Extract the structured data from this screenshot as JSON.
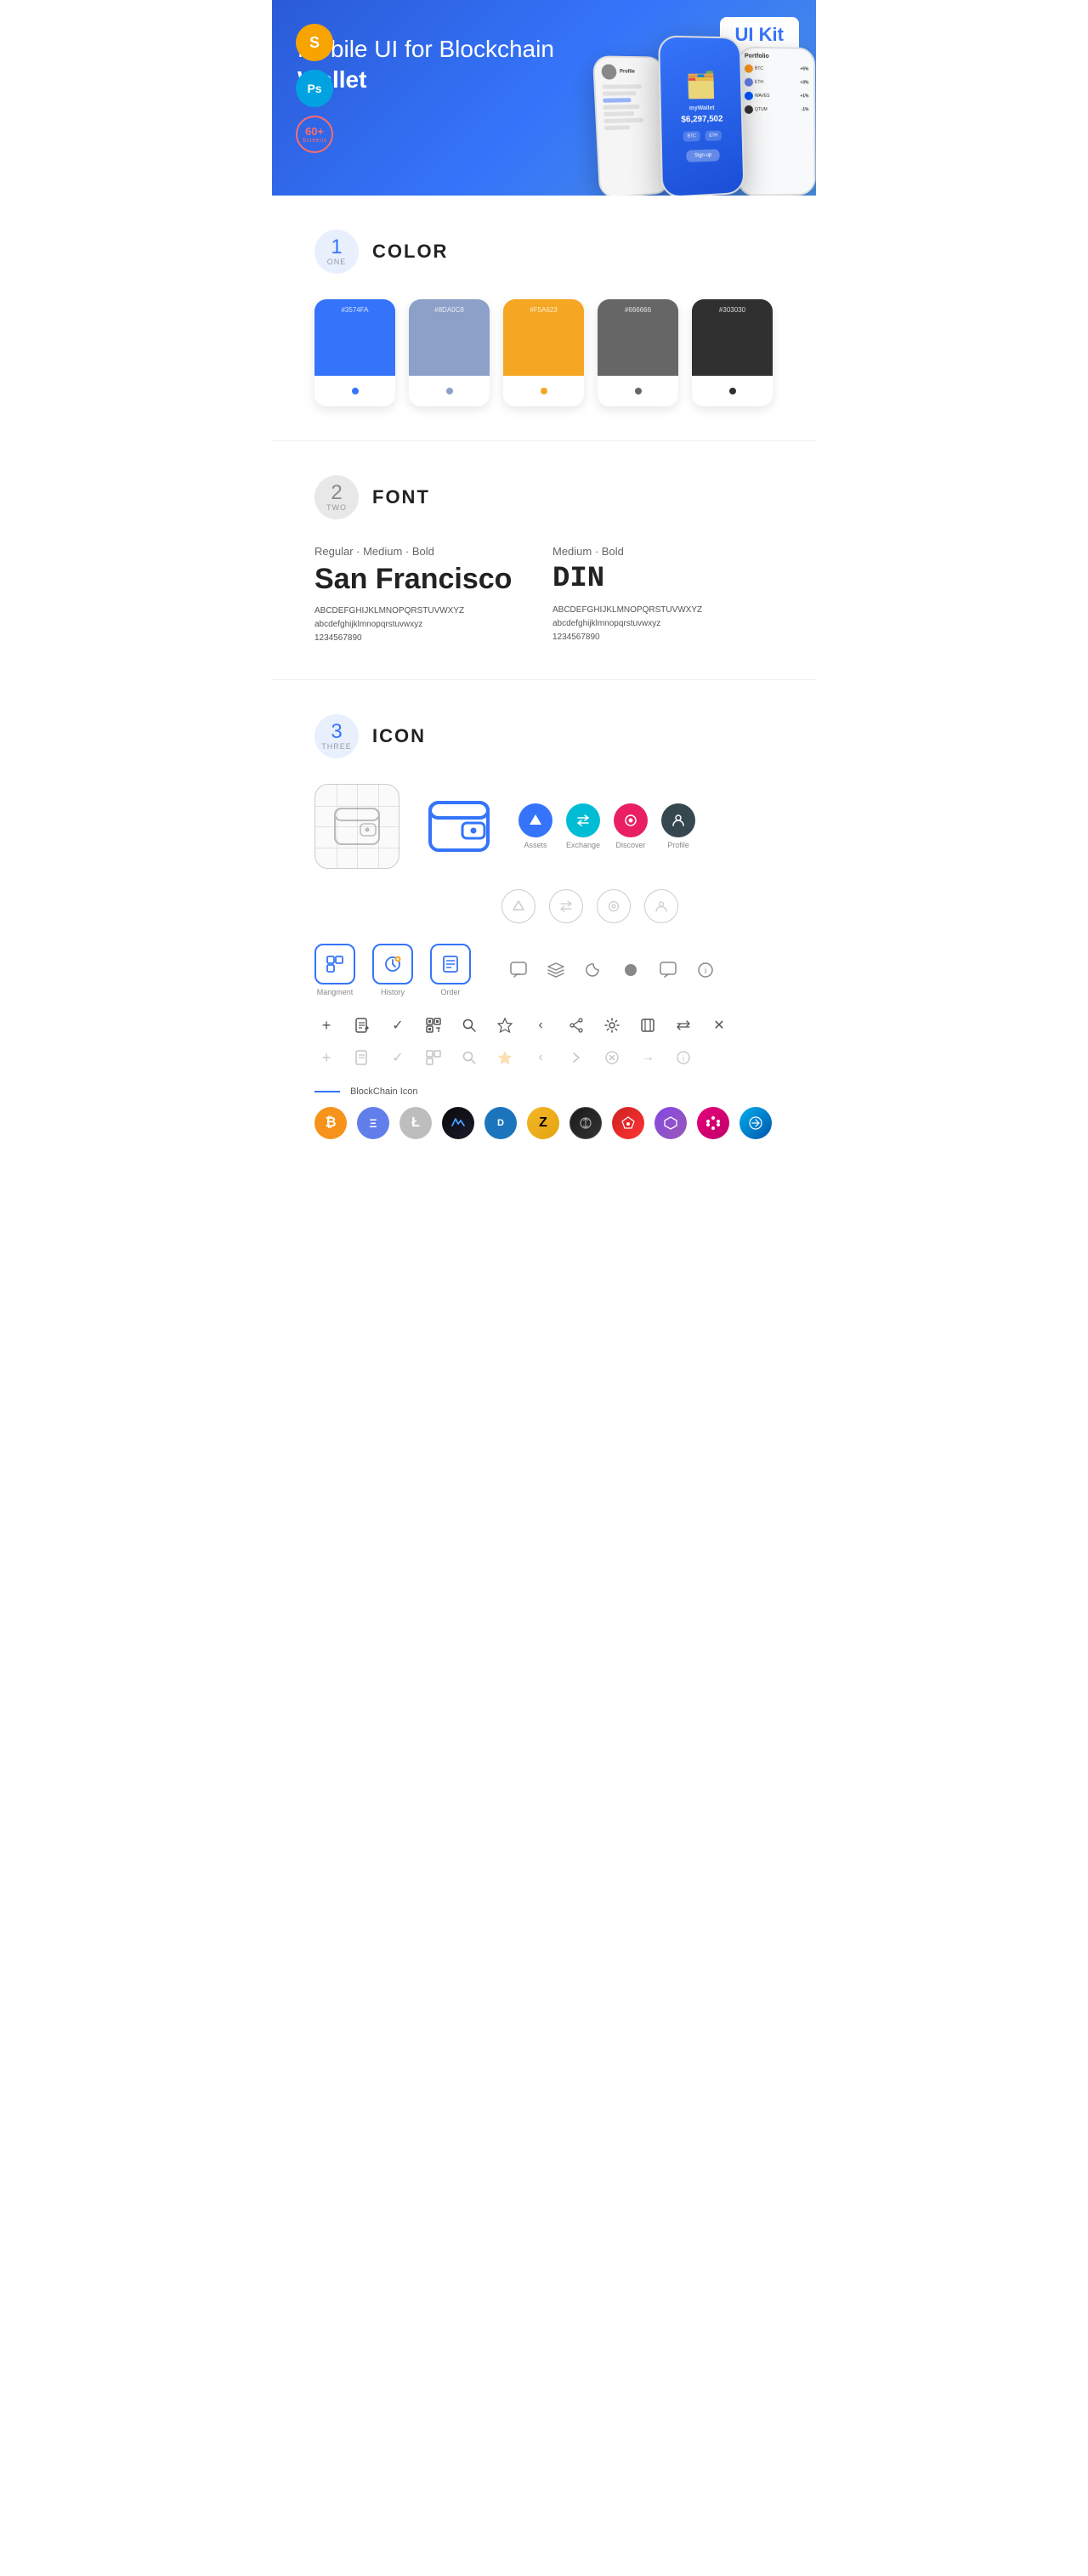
{
  "hero": {
    "title_regular": "Mobile UI for Blockchain ",
    "title_bold": "Wallet",
    "badge": "UI Kit",
    "tools": [
      {
        "name": "Sketch",
        "symbol": "S"
      },
      {
        "name": "Photoshop",
        "symbol": "Ps"
      }
    ],
    "screens_count": "60+",
    "screens_label": "Screens"
  },
  "sections": {
    "color": {
      "number": "1",
      "word": "ONE",
      "title": "COLOR",
      "swatches": [
        {
          "hex": "#3574FA",
          "label": "#3574FA",
          "dot_color": "#fff"
        },
        {
          "hex": "#8DA0C8",
          "label": "#8DA0C8",
          "dot_color": "#fff"
        },
        {
          "hex": "#F5A623",
          "label": "#F5A623",
          "dot_color": "#fff"
        },
        {
          "hex": "#666666",
          "label": "#666666",
          "dot_color": "#fff"
        },
        {
          "hex": "#303030",
          "label": "#303030",
          "dot_color": "#fff"
        }
      ]
    },
    "font": {
      "number": "2",
      "word": "TWO",
      "title": "FONT",
      "fonts": [
        {
          "style_label": "Regular · Medium · Bold",
          "name": "San Francisco",
          "uppercase": "ABCDEFGHIJKLMNOPQRSTUVWXYZ",
          "lowercase": "abcdefghijklmnopqrstuvwxyz",
          "numbers": "1234567890"
        },
        {
          "style_label": "Medium · Bold",
          "name": "DIN",
          "uppercase": "ABCDEFGHIJKLMNOPQRSTUVWXYZ",
          "lowercase": "abcdefghijklmnopqrstuvwxyz",
          "numbers": "1234567890"
        }
      ]
    },
    "icon": {
      "number": "3",
      "word": "THREE",
      "title": "ICON",
      "nav_icons": [
        {
          "label": "Assets",
          "type": "circle-blue",
          "symbol": "◆"
        },
        {
          "label": "Exchange",
          "type": "circle-teal",
          "symbol": "↔"
        },
        {
          "label": "Discover",
          "type": "circle-pink",
          "symbol": "●"
        },
        {
          "label": "Profile",
          "type": "circle-dark",
          "symbol": "👤"
        }
      ],
      "nav_icons_outline": [
        {
          "label": "",
          "type": "outline",
          "symbol": "◆"
        },
        {
          "label": "",
          "type": "outline",
          "symbol": "↔"
        },
        {
          "label": "",
          "type": "outline",
          "symbol": "●"
        },
        {
          "label": "",
          "type": "outline",
          "symbol": "👤"
        }
      ],
      "action_icons_row1": [
        {
          "label": "Mangment",
          "symbol": "▣"
        },
        {
          "label": "History",
          "symbol": "⏱"
        },
        {
          "label": "Order",
          "symbol": "📋"
        }
      ],
      "misc_icons": [
        "💬",
        "≡",
        "◐",
        "●",
        "💬",
        "ℹ"
      ],
      "tool_icons": [
        "+",
        "📋",
        "✓",
        "⊞",
        "🔍",
        "☆",
        "‹",
        "⟨",
        "⚙",
        "⬜",
        "⟷",
        "✕"
      ],
      "tool_icons_faded": [
        "+",
        "📋",
        "✓",
        "⊞",
        "🔍",
        "☆",
        "‹",
        "⟨",
        "⊘",
        "→",
        "✕"
      ],
      "blockchain_label": "BlockChain Icon",
      "crypto_coins": [
        {
          "symbol": "₿",
          "name": "Bitcoin",
          "class": "crypto-btc"
        },
        {
          "symbol": "Ξ",
          "name": "Ethereum",
          "class": "crypto-eth"
        },
        {
          "symbol": "Ł",
          "name": "Litecoin",
          "class": "crypto-ltc"
        },
        {
          "symbol": "W",
          "name": "Waves",
          "class": "crypto-waves"
        },
        {
          "symbol": "D",
          "name": "Dash",
          "class": "crypto-dash"
        },
        {
          "symbol": "Z",
          "name": "Zcash",
          "class": "crypto-zcash"
        },
        {
          "symbol": "I",
          "name": "IOTA",
          "class": "crypto-iota"
        },
        {
          "symbol": "A",
          "name": "Ark",
          "class": "crypto-ark"
        },
        {
          "symbol": "N",
          "name": "NEO",
          "class": "crypto-neo"
        },
        {
          "symbol": "M",
          "name": "Matic",
          "class": "crypto-matic"
        },
        {
          "symbol": "P",
          "name": "Polkadot",
          "class": "crypto-dot"
        }
      ]
    }
  }
}
